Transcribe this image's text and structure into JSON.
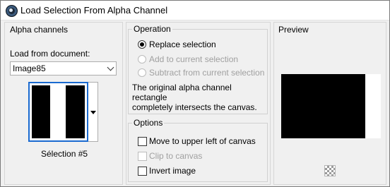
{
  "window": {
    "title": "Load Selection From Alpha Channel"
  },
  "alpha_channels": {
    "heading": "Alpha channels",
    "load_from_label": "Load from document:",
    "document_value": "Image85",
    "selection_caption": "Sélection #5"
  },
  "operation": {
    "heading": "Operation",
    "options": [
      {
        "label": "Replace selection",
        "checked": true,
        "enabled": true
      },
      {
        "label": "Add to current selection",
        "checked": false,
        "enabled": false
      },
      {
        "label": "Subtract from current selection",
        "checked": false,
        "enabled": false
      }
    ],
    "info_line1": "The original alpha channel rectangle",
    "info_line2": "completely intersects the canvas."
  },
  "options_group": {
    "heading": "Options",
    "items": [
      {
        "label": "Move to upper left of canvas",
        "checked": false,
        "enabled": true
      },
      {
        "label": "Clip to canvas",
        "checked": false,
        "enabled": false
      },
      {
        "label": "Invert image",
        "checked": false,
        "enabled": true
      }
    ]
  },
  "preview": {
    "heading": "Preview"
  },
  "icons": {
    "app": "app-icon",
    "dropdown": "chevron-down-icon",
    "thumb_dropdown": "triangle-down-icon",
    "transparency": "checkerboard-icon"
  }
}
